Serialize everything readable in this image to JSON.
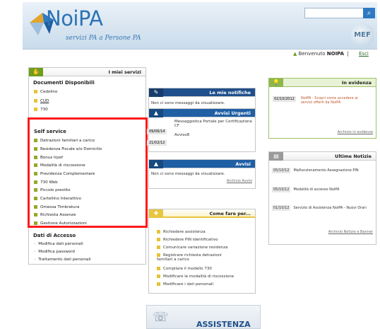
{
  "header": {
    "logo_main": "NoiPA",
    "logo_tagline": "servizi PA a Persone PA",
    "search_button_glyph": "⌕",
    "mef_label": "MEF",
    "welcome_prefix": "Benvenuto",
    "welcome_user": "NOIPA",
    "separator": "|",
    "logout_label": "Esci"
  },
  "servizi": {
    "title": "I miei servizi",
    "documenti_heading": "Documenti Disponibili",
    "documenti": [
      "Cedolino",
      "CUD",
      "730"
    ],
    "self_service_heading": "Self service",
    "self_service": [
      "Detrazioni familiari a carico",
      "Residenza Fiscale e/o Domicilio",
      "Bonus Irpef",
      "Modalità di riscossione",
      "Previdenza Complementare",
      "730 Web",
      "Piccolo prestito",
      "Cartellino Interattivo",
      "Omessa Timbratura",
      "Richiesta Assenze",
      "Gestione Autorizzazioni"
    ],
    "accesso_heading": "Dati di Accesso",
    "accesso": [
      "Modifica dati personali",
      "Modifica password",
      "Trattamento dati personali"
    ]
  },
  "notifiche": {
    "title": "Le mie notifiche",
    "message": "Non ci sono messaggi da visualizzare."
  },
  "urgenti": {
    "title": "Avvisi Urgenti",
    "items": [
      {
        "date": "09/06/14",
        "text": "Messaggistica Portale per Certificazione CF"
      },
      {
        "date": "21/02/12",
        "text": "Avviso8"
      }
    ]
  },
  "avvisi": {
    "title": "Avvisi",
    "message": "Non ci sono messaggi da visualizzare.",
    "archive_link": "Archivio Avvisi"
  },
  "come_fare": {
    "title": "Come fare per...",
    "items": [
      "Richiedere assistenza",
      "Richiedere PIN identificativo",
      "Comunicare variazione residenza",
      "Registrare richiesta detrazioni familiari a carico",
      "Compilare il modello 730",
      "Modificare le modalità di riscossione",
      "Modificare i dati personali"
    ]
  },
  "evidenza": {
    "title": "In evidenza",
    "items": [
      {
        "date": "02/10/2012",
        "text": "NoiPA - Scopri come accedere ai servizi offerti da NoiPA"
      }
    ],
    "archive_link": "Archivio in evidenza"
  },
  "notizie": {
    "title": "Ultime Notizie",
    "items": [
      {
        "date": "05/10/12",
        "text": "Malfunzionamento Assegnazione PIN"
      },
      {
        "date": "05/10/12",
        "text": "Modalità di accesso NoiPA"
      },
      {
        "date": "01/10/12",
        "text": "Servizio di Assistenza NoiPA - Nuovi Orari"
      }
    ],
    "archive_link": "Archivio Notizie e Banner"
  },
  "assistenza_banner": "ASSISTENZA",
  "colors": {
    "accent_green": "#6f9d1d",
    "accent_blue": "#1f5fa4",
    "accent_yellow": "#e8c640",
    "highlight_red": "#ff1a1a"
  }
}
